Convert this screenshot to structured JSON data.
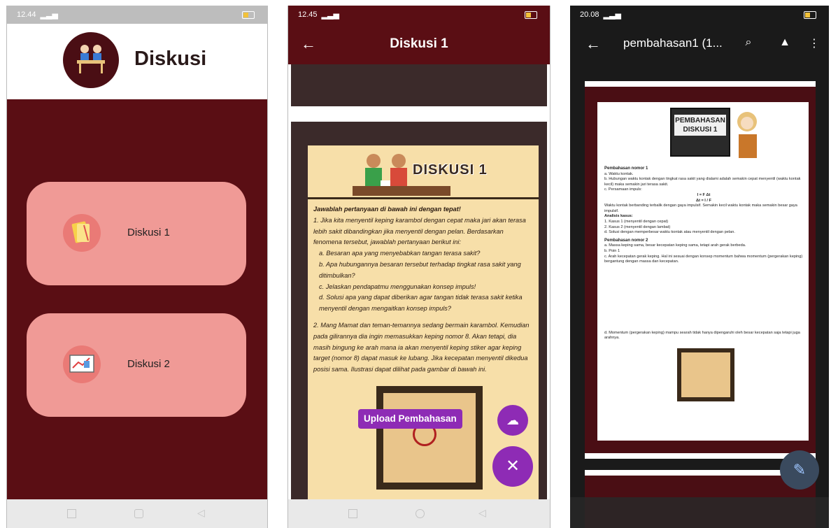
{
  "phone1": {
    "status_time": "12.44",
    "title": "Diskusi",
    "menu": [
      {
        "label": "Diskusi 1",
        "icon": "notes-icon"
      },
      {
        "label": "Diskusi 2",
        "icon": "whiteboard-icon"
      }
    ]
  },
  "phone2": {
    "status_time": "12.45",
    "title": "Diskusi 1",
    "worksheet_title": "DISKUSI 1",
    "instructions": "Jawablah pertanyaan di bawah ini dengan tepat!",
    "q1": "1. Jika kita menyentil keping karambol dengan cepat maka jari akan terasa lebih sakit dibandingkan jika menyentil dengan pelan. Berdasarkan fenomena tersebut, jawablah pertanyaan berikut ini:",
    "q1a": "a. Besaran apa yang menyebabkan tangan terasa sakit?",
    "q1b": "b. Apa hubungannya besaran tersebut terhadap tingkat rasa sakit yang ditimbulkan?",
    "q1c": "c. Jelaskan pendapatmu menggunakan konsep impuls!",
    "q1d": "d. Solusi apa yang dapat diberikan agar tangan tidak terasa sakit ketika menyentil dengan mengaitkan konsep impuls?",
    "q2": "2. Mang Mamat dan teman-temannya sedang bermain karambol. Kemudian pada gilirannya dia ingin memasukkan keping nomor 8. Akan tetapi, dia masih bingung ke arah mana ia akan menyentil keping stiker agar keping target (nomor 8) dapat masuk ke lubang. Jika kecepatan menyentil dikedua posisi sama. Ilustrasi dapat dilihat pada gambar di bawah ini.",
    "upload_label": "Upload Pembahasan"
  },
  "phone3": {
    "status_time": "20.08",
    "title": "pembahasan1 (1...",
    "banner": "PEMBAHASAN DISKUSI 1",
    "section1": "Pembahasan nomor 1",
    "s1a": "a. Waktu kontak.",
    "s1b": "b. Hubungan waktu kontak dengan tingkat rasa sakit yang dialami adalah semakin cepat menyentil (waktu kontak kecil) maka semakin jari terasa sakit.",
    "s1c": "c. Persamaan impuls:",
    "eq1": "I = F Δt",
    "eq2": "Δt = I / F",
    "s1c_note": "Waktu kontak berbanding terbalik dengan gaya impulsif. Semakin kecil waktu kontak maka semakin besar gaya impulsif.",
    "analysis": "Analisis kasus:",
    "case1": "1. Kasus 1 (menyentil dengan cepat)",
    "case2": "2. Kasus 2 (menyentil dengan lambat)",
    "s1d": "d. Solusi dengan memperbesar waktu kontak atau menyentil dengan pelan.",
    "section2": "Pembahasan nomor 2",
    "s2a": "a. Massa keping sama, besar kecepatan keping sama, tetapi arah gerak berbeda.",
    "s2b": "b. Poin 1",
    "s2c": "c. Arah kecepatan gerak keping. Hal ini sesuai dengan konsep momentum bahwa momentum (pergerakan keping) bergantung dengan massa dan kecepatan.",
    "s2d": "d. Momentum (pergerakan keping) mampu searah tidak hanya dipengaruhi oleh besar kecepatan saja tetapi juga arahnya."
  },
  "colors": {
    "maroon": "#5a0e14",
    "card_pink": "#f09a96",
    "fab_purple": "#8e2bb5",
    "paper": "#f7dfa9"
  }
}
